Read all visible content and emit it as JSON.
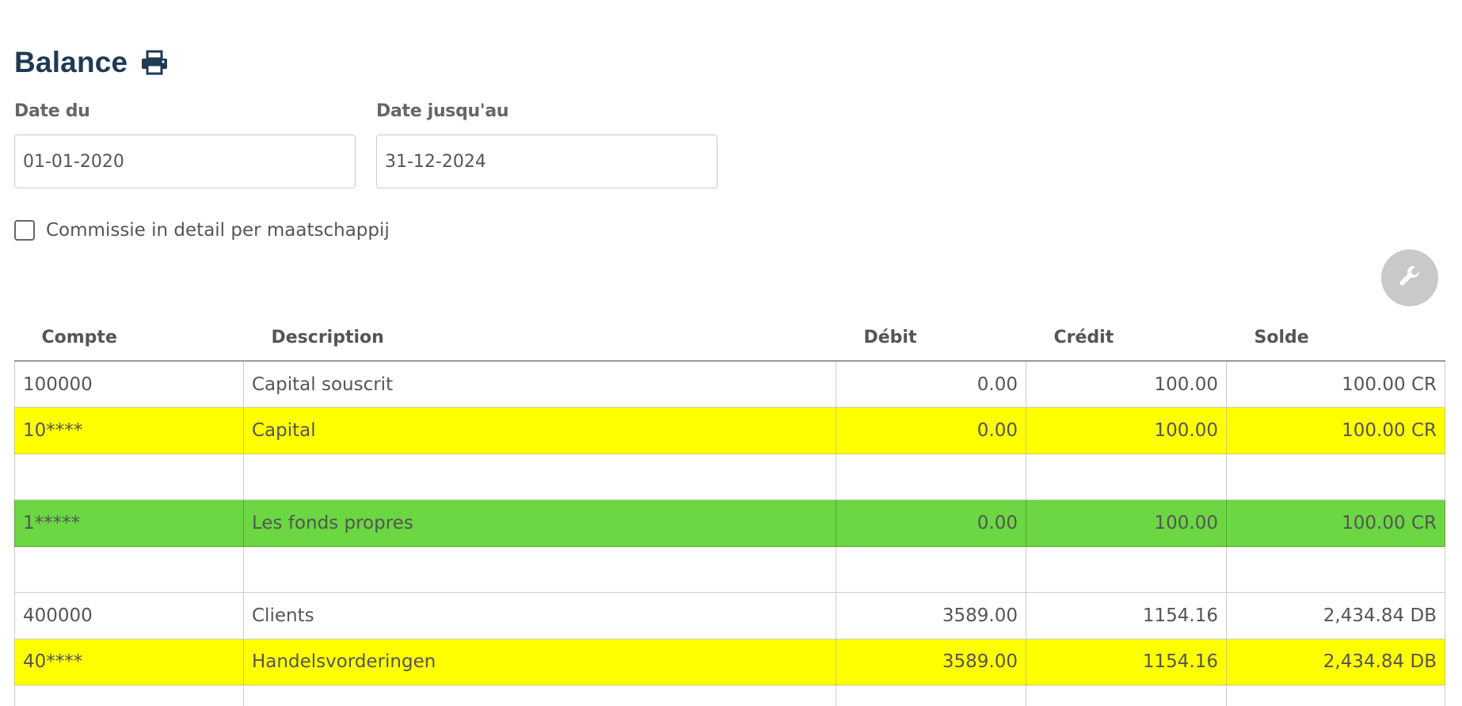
{
  "header": {
    "title": "Balance",
    "print_icon": "print-icon"
  },
  "filters": {
    "date_from_label": "Date du",
    "date_from_value": "01-01-2020",
    "date_to_label": "Date jusqu'au",
    "date_to_value": "31-12-2024",
    "checkbox_label": "Commissie in detail per maatschappij",
    "checkbox_checked": false
  },
  "tools": {
    "settings_icon": "wrench-icon"
  },
  "colors": {
    "title": "#1f3a52",
    "highlight_yellow": "#ffff00",
    "highlight_green": "#6bd742",
    "tool_button": "#c9c9c9"
  },
  "table": {
    "columns": [
      "Compte",
      "Description",
      "Débit",
      "Crédit",
      "Solde"
    ],
    "rows": [
      {
        "account": "100000",
        "description": "Capital souscrit",
        "debit": "0.00",
        "credit": "100.00",
        "balance": "100.00 CR",
        "style": "normal"
      },
      {
        "account": "10****",
        "description": "Capital",
        "debit": "0.00",
        "credit": "100.00",
        "balance": "100.00 CR",
        "style": "yellow"
      },
      {
        "account": "",
        "description": "",
        "debit": "",
        "credit": "",
        "balance": "",
        "style": "normal"
      },
      {
        "account": "1*****",
        "description": "Les fonds propres",
        "debit": "0.00",
        "credit": "100.00",
        "balance": "100.00 CR",
        "style": "green"
      },
      {
        "account": "",
        "description": "",
        "debit": "",
        "credit": "",
        "balance": "",
        "style": "normal"
      },
      {
        "account": "400000",
        "description": "Clients",
        "debit": "3589.00",
        "credit": "1154.16",
        "balance": "2,434.84 DB",
        "style": "normal"
      },
      {
        "account": "40****",
        "description": "Handelsvorderingen",
        "debit": "3589.00",
        "credit": "1154.16",
        "balance": "2,434.84 DB",
        "style": "yellow"
      },
      {
        "account": "",
        "description": "",
        "debit": "",
        "credit": "",
        "balance": "",
        "style": "normal"
      }
    ]
  }
}
